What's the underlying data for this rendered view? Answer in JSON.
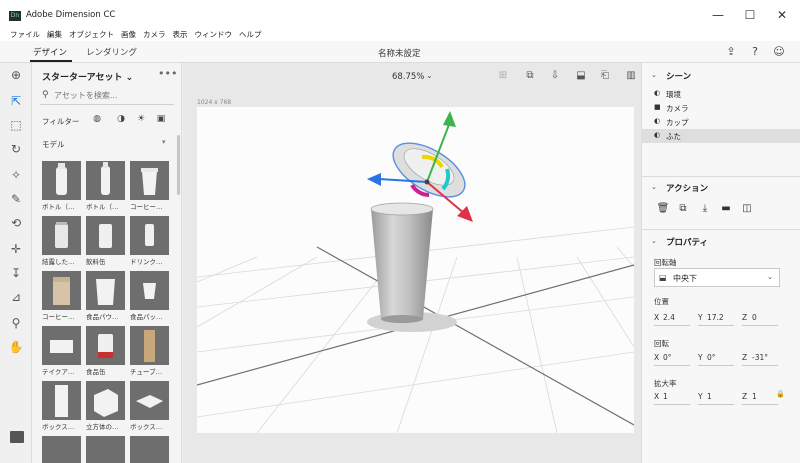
{
  "window": {
    "app_icon_text": "Dn",
    "title": "Adobe Dimension CC",
    "minimize": "—",
    "maximize": "☐",
    "close": "✕"
  },
  "menu": [
    "ファイル",
    "編集",
    "オブジェクト",
    "画像",
    "カメラ",
    "表示",
    "ウィンドウ",
    "ヘルプ"
  ],
  "tabs": {
    "design": "デザイン",
    "render": "レンダリング"
  },
  "document_title": "名称未設定",
  "assets": {
    "title": "スターターアセット ⌄",
    "search_placeholder": "アセットを検索...",
    "filter_label": "フィルター",
    "section_label": "モデル",
    "items": [
      {
        "label": "ボトル（…"
      },
      {
        "label": "ボトル（…"
      },
      {
        "label": "コーヒー…"
      },
      {
        "label": "結露した…"
      },
      {
        "label": "飲料缶"
      },
      {
        "label": "ドリンク…"
      },
      {
        "label": "コーヒー…"
      },
      {
        "label": "食品パウ…"
      },
      {
        "label": "食品パッ…"
      },
      {
        "label": "テイクア…"
      },
      {
        "label": "食品缶"
      },
      {
        "label": "チューブ…"
      },
      {
        "label": "ボックス…"
      },
      {
        "label": "立方体の…"
      },
      {
        "label": "ボックス…"
      }
    ]
  },
  "viewport": {
    "zoom": "68.75%",
    "canvas_size": "1024 x 768"
  },
  "scene": {
    "title": "シーン",
    "items": [
      {
        "label": "環境",
        "icon": "◐"
      },
      {
        "label": "カメラ",
        "icon": "■"
      },
      {
        "label": "カップ",
        "icon": "◐"
      },
      {
        "label": "ふた",
        "icon": "◐",
        "selected": true
      }
    ]
  },
  "actions": {
    "title": "アクション"
  },
  "properties": {
    "title": "プロパティ",
    "pivot_label": "回転軸",
    "pivot_value": "中央下",
    "position_label": "位置",
    "position": {
      "x": "2.4",
      "y": "17.2",
      "z": "0"
    },
    "rotation_label": "回転",
    "rotation": {
      "x": "0°",
      "y": "0°",
      "z": "-31°"
    },
    "scale_label": "拡大率",
    "scale": {
      "x": "1",
      "y": "1",
      "z": "1"
    }
  },
  "colors": {
    "accent": "#1473e6",
    "gizmo_green": "#3cb44b",
    "gizmo_red": "#e0304a",
    "gizmo_blue": "#2874e6",
    "selection": "#5b8ee0"
  }
}
